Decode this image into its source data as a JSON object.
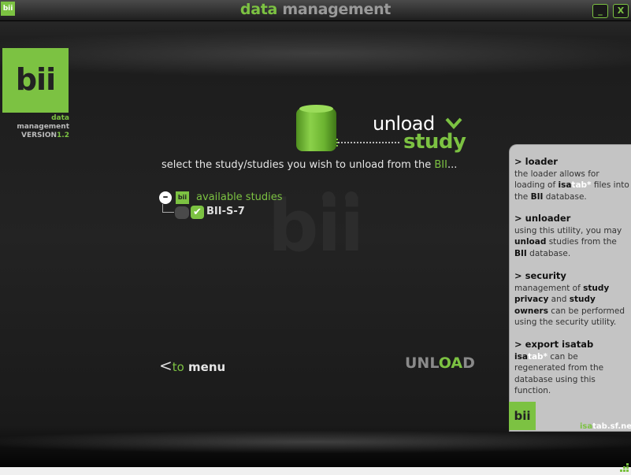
{
  "window": {
    "logo_text": "bii",
    "title_part1": "data",
    "title_part2": " management",
    "minimize_label": "_",
    "close_label": "X"
  },
  "brand": {
    "logo_text": "bii",
    "subtitle_green": "data",
    "subtitle_white": " management",
    "version_prefix": "VERSION",
    "version_number": "1.2"
  },
  "header": {
    "unload_word": "unload",
    "study_word": "study"
  },
  "instruction": {
    "text_before": "select the study/studies you wish to unload from the ",
    "highlight": "BII",
    "text_after": "..."
  },
  "watermark": "bii",
  "tree": {
    "toggle_symbol": "–",
    "root_icon_text": "bii",
    "root_label": "available studies",
    "items": [
      {
        "label": "BII-S-7",
        "checked": true
      }
    ]
  },
  "nav": {
    "back_arrow": "<",
    "back_to": "to",
    "back_menu": " menu",
    "unload_part1": "UNL",
    "unload_part2": "OA",
    "unload_part3": "D"
  },
  "side_panel": {
    "loader": {
      "heading": "> loader",
      "text1": "the loader allows for loading of ",
      "isa": "isa",
      "tab": "tab*",
      "text2": " files into the ",
      "bii": "BII",
      "text3": " database."
    },
    "unloader": {
      "heading": "> unloader",
      "text1": "using this utility, you may ",
      "unload": "unload",
      "text2": " studies from the ",
      "bii": "BII",
      "text3": " database."
    },
    "security": {
      "heading": "> security",
      "text1": "management of ",
      "study_privacy": "study privacy",
      "text2": " and ",
      "study_owners": "study owners",
      "text3": " can be performed using the security utility."
    },
    "export": {
      "heading": "> export isatab",
      "isa": "isa",
      "tab": "tab*",
      "text1": " can be regenerated from the database using this function."
    },
    "footer_logo": "bii",
    "url_green": "isa",
    "url_white": "tab.sf.net"
  }
}
